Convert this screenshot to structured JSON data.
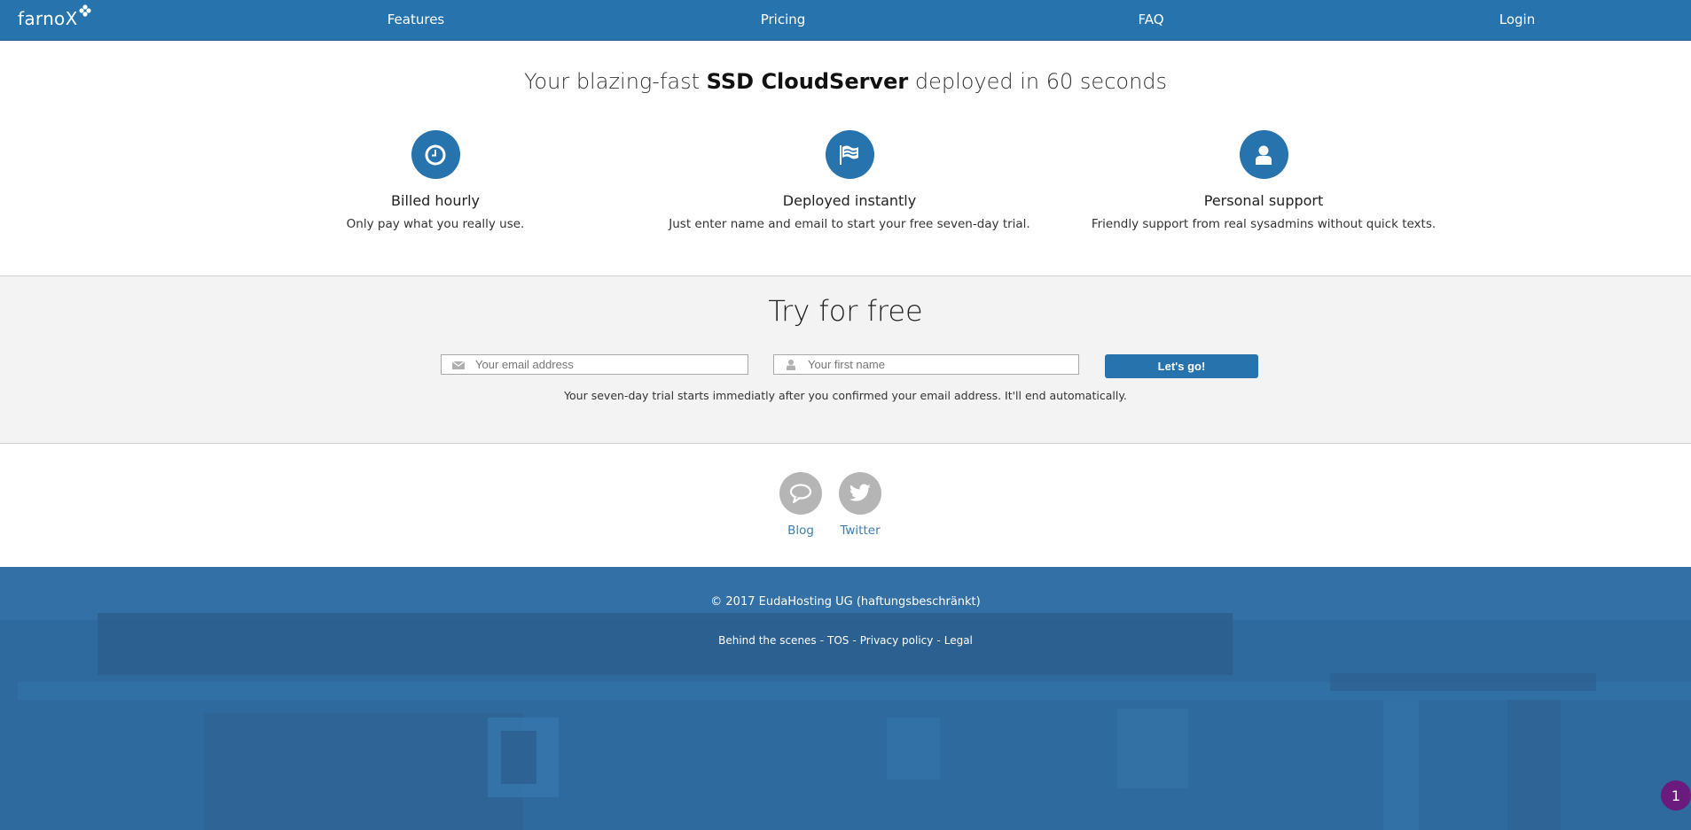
{
  "nav": {
    "logo": "farnoX",
    "items": [
      {
        "label": "Features"
      },
      {
        "label": "Pricing"
      },
      {
        "label": "FAQ"
      },
      {
        "label": "Login"
      }
    ]
  },
  "hero": {
    "title_pre": "Your blazing-fast ",
    "title_bold": "SSD CloudServer",
    "title_post": " deployed in 60 seconds"
  },
  "features": [
    {
      "icon": "clock-icon",
      "title": "Billed hourly",
      "desc": "Only pay what you really use."
    },
    {
      "icon": "flag-icon",
      "title": "Deployed instantly",
      "desc": "Just enter name and email to start your free seven-day trial."
    },
    {
      "icon": "user-icon",
      "title": "Personal support",
      "desc": "Friendly support from real sysadmins without quick texts."
    }
  ],
  "trial": {
    "title": "Try for free",
    "email_placeholder": "Your email address",
    "email_value": "",
    "name_placeholder": "Your first name",
    "name_value": "",
    "button_label": "Let's go!",
    "note": "Your seven-day trial starts immediatly after you confirmed your email address. It'll end automatically."
  },
  "social": [
    {
      "icon": "speech-bubble-icon",
      "label": "Blog"
    },
    {
      "icon": "twitter-icon",
      "label": "Twitter"
    }
  ],
  "footer": {
    "copyright": "© 2017 EudaHosting UG (haftungsbeschränkt)",
    "links": [
      {
        "label": "Behind the scenes"
      },
      {
        "label": "TOS"
      },
      {
        "label": "Privacy policy"
      },
      {
        "label": "Legal"
      }
    ],
    "separator": "-"
  },
  "notification_badge": {
    "count": "1"
  },
  "colors": {
    "brand": "#2673ae",
    "footer": "#2f6a9e",
    "section_bg": "#f3f3f3",
    "social_grey": "#b5b5b5",
    "link": "#3a7fb0",
    "badge": "#6b1a7e"
  }
}
